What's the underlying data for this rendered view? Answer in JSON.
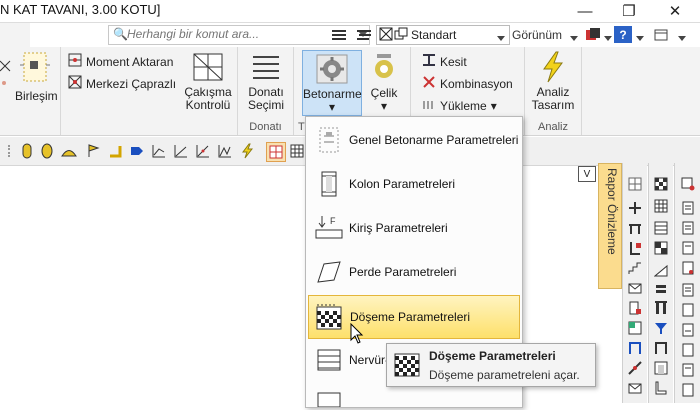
{
  "window": {
    "title": "N KAT TAVANI,  3.00 KOTU]",
    "minimize_glyph": "—",
    "maximize_glyph": "❐",
    "close_glyph": "✕"
  },
  "toolbar": {
    "search_placeholder": "Herhangi bir komut ara...",
    "style_selected": "Standart",
    "view_label": "Görünüm",
    "help_glyph": "?",
    "icons": [
      "layers-icon",
      "layer-stack-icon",
      "cross-box-icon",
      "copy-icon",
      "dropdown-icon",
      "dropdown-icon",
      "user-icon",
      "help-icon"
    ]
  },
  "ribbon": {
    "birlesim": "Birleşim",
    "moment_aktaran": "Moment Aktaran",
    "merkezi_caprazli": "Merkezi Çaprazlı",
    "cakisma_l1": "Çakışma",
    "cakisma_l2": "Kontrolü",
    "donati_secimi_l1": "Donatı",
    "donati_secimi_l2": "Seçimi",
    "donati_group": "Donatı",
    "betonarme": "Betonarme",
    "celik": "Çelik",
    "kesit": "Kesit",
    "kombinasyon": "Kombinasyon",
    "yukleme": "Yükleme",
    "analiz_l1": "Analiz",
    "analiz_l2": "Tasarım",
    "analiz_group": "Analiz",
    "partial_group": "T",
    "dropdown_glyph": "▾",
    "arrow_glyph": "▾"
  },
  "menu": {
    "items": [
      {
        "label": "Genel Betonarme Parametreleri",
        "icon": "general-params-icon"
      },
      {
        "label": "Kolon Parametreleri",
        "icon": "column-params-icon"
      },
      {
        "label": "Kiriş Parametreleri",
        "icon": "beam-params-icon"
      },
      {
        "label": "Perde Parametreleri",
        "icon": "wall-params-icon"
      },
      {
        "label": "Döşeme Parametreleri",
        "icon": "slab-params-icon"
      },
      {
        "label": "Nervür-",
        "icon": "rib-params-icon"
      }
    ],
    "active_index": 4
  },
  "tooltip": {
    "title": "Döşeme Parametreleri",
    "description": "Döşeme parametreleni açar."
  },
  "panel": {
    "rapor": "Rapor Önizleme",
    "v_button": "V"
  },
  "colors": {
    "menu_highlight": "#fde06b",
    "rapor_tab": "#fbdc8e",
    "ribbon_bg": "#f3f3f3"
  }
}
